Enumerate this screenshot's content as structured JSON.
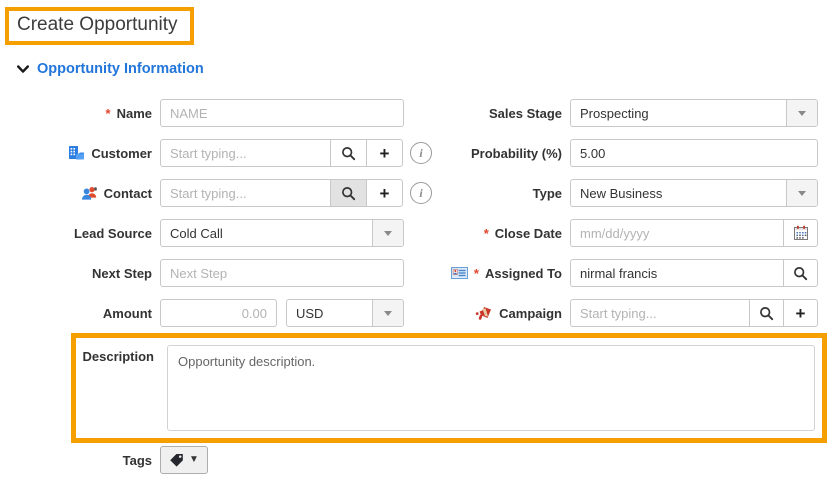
{
  "ui": {
    "required_marker": "*"
  },
  "colors": {
    "highlight_orange": "#F5A000",
    "section_title_blue": "#2275DB",
    "required_red": "#E0442E",
    "label_text": "#333333",
    "placeholder_text": "#B3B3B3"
  },
  "header": {
    "title": "Create Opportunity"
  },
  "section": {
    "title": "Opportunity Information"
  },
  "icons": {
    "plus": "+",
    "info": "i",
    "caret_down": "▼"
  },
  "fields": {
    "name": {
      "label": "Name",
      "required": true,
      "placeholder": "NAME"
    },
    "customer": {
      "label": "Customer",
      "placeholder": "Start typing..."
    },
    "contact": {
      "label": "Contact",
      "placeholder": "Start typing..."
    },
    "lead_source": {
      "label": "Lead Source",
      "value": "Cold Call"
    },
    "next_step": {
      "label": "Next Step",
      "placeholder": "Next Step"
    },
    "amount": {
      "label": "Amount",
      "placeholder": "0.00",
      "currency": "USD"
    },
    "sales_stage": {
      "label": "Sales Stage",
      "value": "Prospecting"
    },
    "probability": {
      "label": "Probability (%)",
      "value": "5.00"
    },
    "type": {
      "label": "Type",
      "value": "New Business"
    },
    "close_date": {
      "label": "Close Date",
      "required": true,
      "placeholder": "mm/dd/yyyy"
    },
    "assigned_to": {
      "label": "Assigned To",
      "required": true,
      "value": "nirmal francis"
    },
    "campaign": {
      "label": "Campaign",
      "placeholder": "Start typing..."
    },
    "description": {
      "label": "Description",
      "value": "Opportunity description."
    },
    "tags": {
      "label": "Tags"
    }
  }
}
